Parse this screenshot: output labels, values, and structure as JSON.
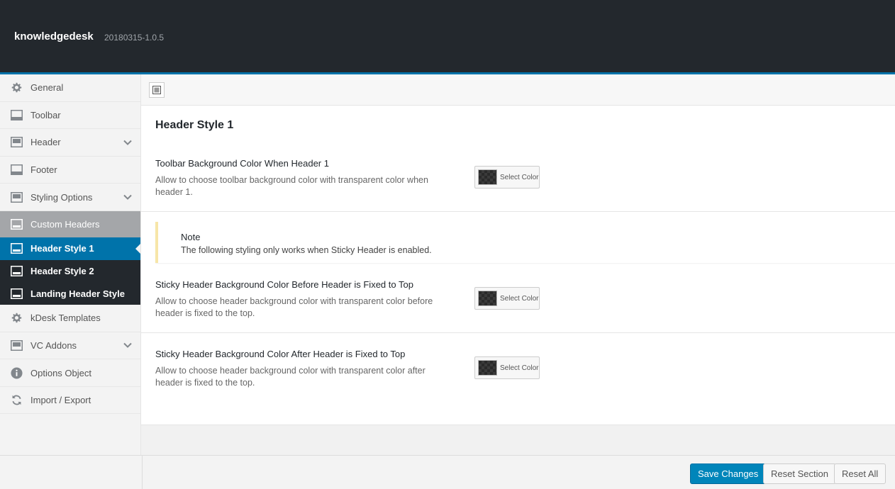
{
  "app": {
    "title": "knowledgedesk",
    "version": "20180315-1.0.5"
  },
  "sidebar": {
    "items": [
      {
        "label": "General",
        "icon": "gear-icon"
      },
      {
        "label": "Toolbar",
        "icon": "panel-icon"
      },
      {
        "label": "Header",
        "icon": "layout-icon",
        "expandable": true
      },
      {
        "label": "Footer",
        "icon": "panel-icon"
      },
      {
        "label": "Styling Options",
        "icon": "layout-icon",
        "expandable": true
      },
      {
        "label": "Custom Headers",
        "icon": "panel-icon"
      }
    ],
    "subitems": [
      {
        "label": "Header Style 1",
        "active": true
      },
      {
        "label": "Header Style 2"
      },
      {
        "label": "Landing Header Style"
      }
    ],
    "after_items": [
      {
        "label": "kDesk Templates",
        "icon": "gear-icon"
      },
      {
        "label": "VC Addons",
        "icon": "layout-icon",
        "expandable": true
      },
      {
        "label": "Options Object",
        "icon": "info-icon"
      },
      {
        "label": "Import / Export",
        "icon": "refresh-icon"
      }
    ]
  },
  "main": {
    "section_title": "Header Style 1",
    "fields": [
      {
        "title": "Toolbar Background Color When Header 1",
        "desc": "Allow to choose toolbar background color with transparent color when header 1.",
        "button_label": "Select Color"
      },
      {
        "title": "Sticky Header Background Color Before Header is Fixed to Top",
        "desc": "Allow to choose header background color with transparent color before header is fixed to the top.",
        "button_label": "Select Color"
      },
      {
        "title": "Sticky Header Background Color After Header is Fixed to Top",
        "desc": "Allow to choose header background color with transparent color after header is fixed to the top.",
        "button_label": "Select Color"
      }
    ],
    "note": {
      "title": "Note",
      "text": "The following styling only works when Sticky Header is enabled."
    }
  },
  "footer": {
    "save_label": "Save Changes",
    "reset_section_label": "Reset Section",
    "reset_all_label": "Reset All"
  },
  "colors": {
    "accent": "#0073aa",
    "topbar": "#23282d",
    "note_border": "#f7e6a8"
  }
}
